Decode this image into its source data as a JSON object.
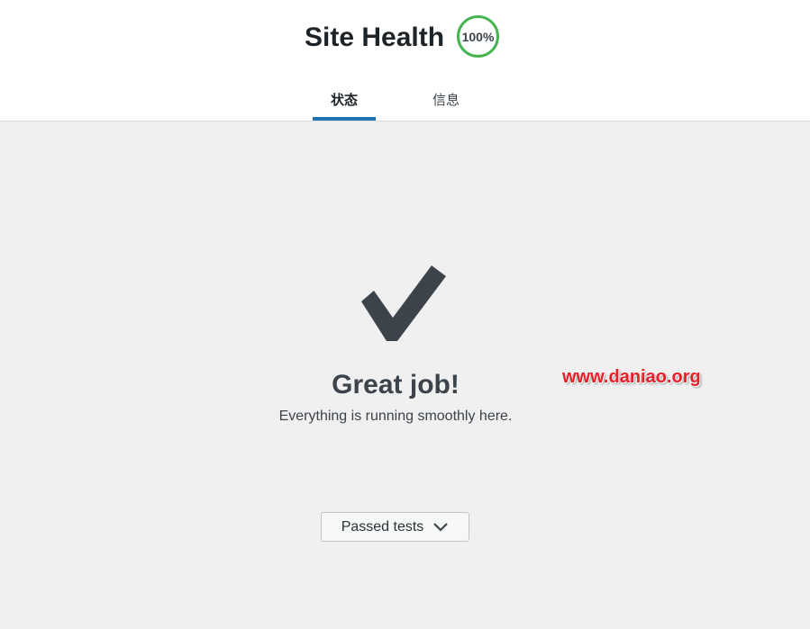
{
  "header": {
    "title": "Site Health",
    "score": "100%",
    "score_color": "#46b450"
  },
  "tabs": [
    {
      "label": "状态",
      "active": true
    },
    {
      "label": "信息",
      "active": false
    }
  ],
  "status": {
    "icon": "checkmark-icon",
    "title": "Great job!",
    "subtitle": "Everything is running smoothly here."
  },
  "watermark": {
    "text": "www.daniao.org",
    "color": "#e8202a"
  },
  "passed_tests": {
    "label": "Passed tests",
    "icon": "chevron-down-icon"
  },
  "colors": {
    "accent": "#2271b1",
    "page_background": "#f0f0f1",
    "header_background": "#ffffff"
  }
}
